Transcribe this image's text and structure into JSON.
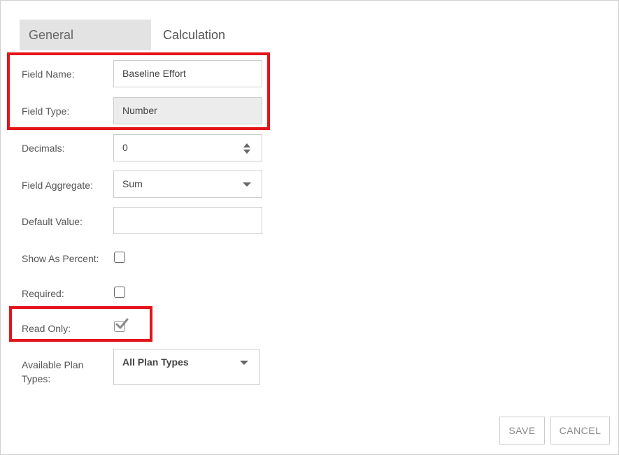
{
  "tabs": {
    "general": "General",
    "calculation": "Calculation"
  },
  "form": {
    "field_name": {
      "label": "Field Name:",
      "value": "Baseline Effort"
    },
    "field_type": {
      "label": "Field Type:",
      "value": "Number"
    },
    "decimals": {
      "label": "Decimals:",
      "value": "0"
    },
    "field_aggregate": {
      "label": "Field Aggregate:",
      "value": "Sum"
    },
    "default_value": {
      "label": "Default Value:",
      "value": ""
    },
    "show_as_percent": {
      "label": "Show As Percent:",
      "checked": false
    },
    "required": {
      "label": "Required:",
      "checked": false
    },
    "read_only": {
      "label": "Read Only:",
      "checked": true
    },
    "available_plan_types": {
      "label_line1": "Available Plan",
      "label_line2": "Types:",
      "value": "All Plan Types"
    }
  },
  "buttons": {
    "save": "SAVE",
    "cancel": "CANCEL"
  },
  "colors": {
    "highlight": "#e4141b",
    "tab_active_bg": "#e3e3e3",
    "readonly_bg": "#ececec"
  }
}
